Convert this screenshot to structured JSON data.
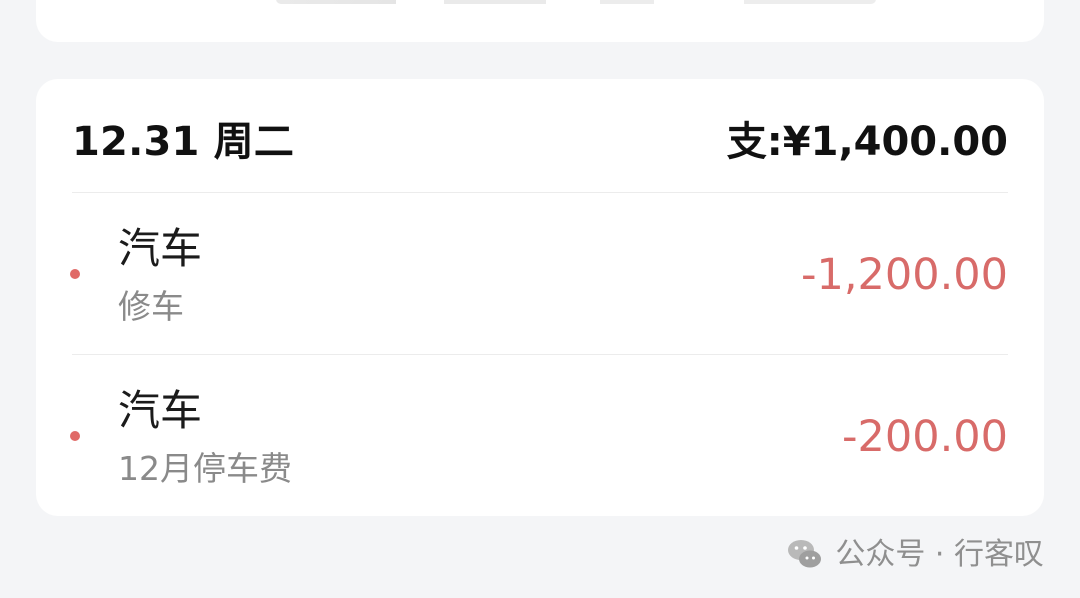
{
  "day": {
    "date_label": "12.31 周二",
    "total_label": "支:¥1,400.00"
  },
  "transactions": [
    {
      "category": "汽车",
      "note": "修车",
      "amount": "-1,200.00"
    },
    {
      "category": "汽车",
      "note": "12月停车费",
      "amount": "-200.00"
    }
  ],
  "watermark": {
    "text": "公众号 · 行客叹",
    "icon": "wechat-icon"
  },
  "colors": {
    "background": "#f4f5f7",
    "card": "#ffffff",
    "expense": "#d86b69",
    "bullet": "#e06a67",
    "muted_text": "#8a8a8a"
  }
}
